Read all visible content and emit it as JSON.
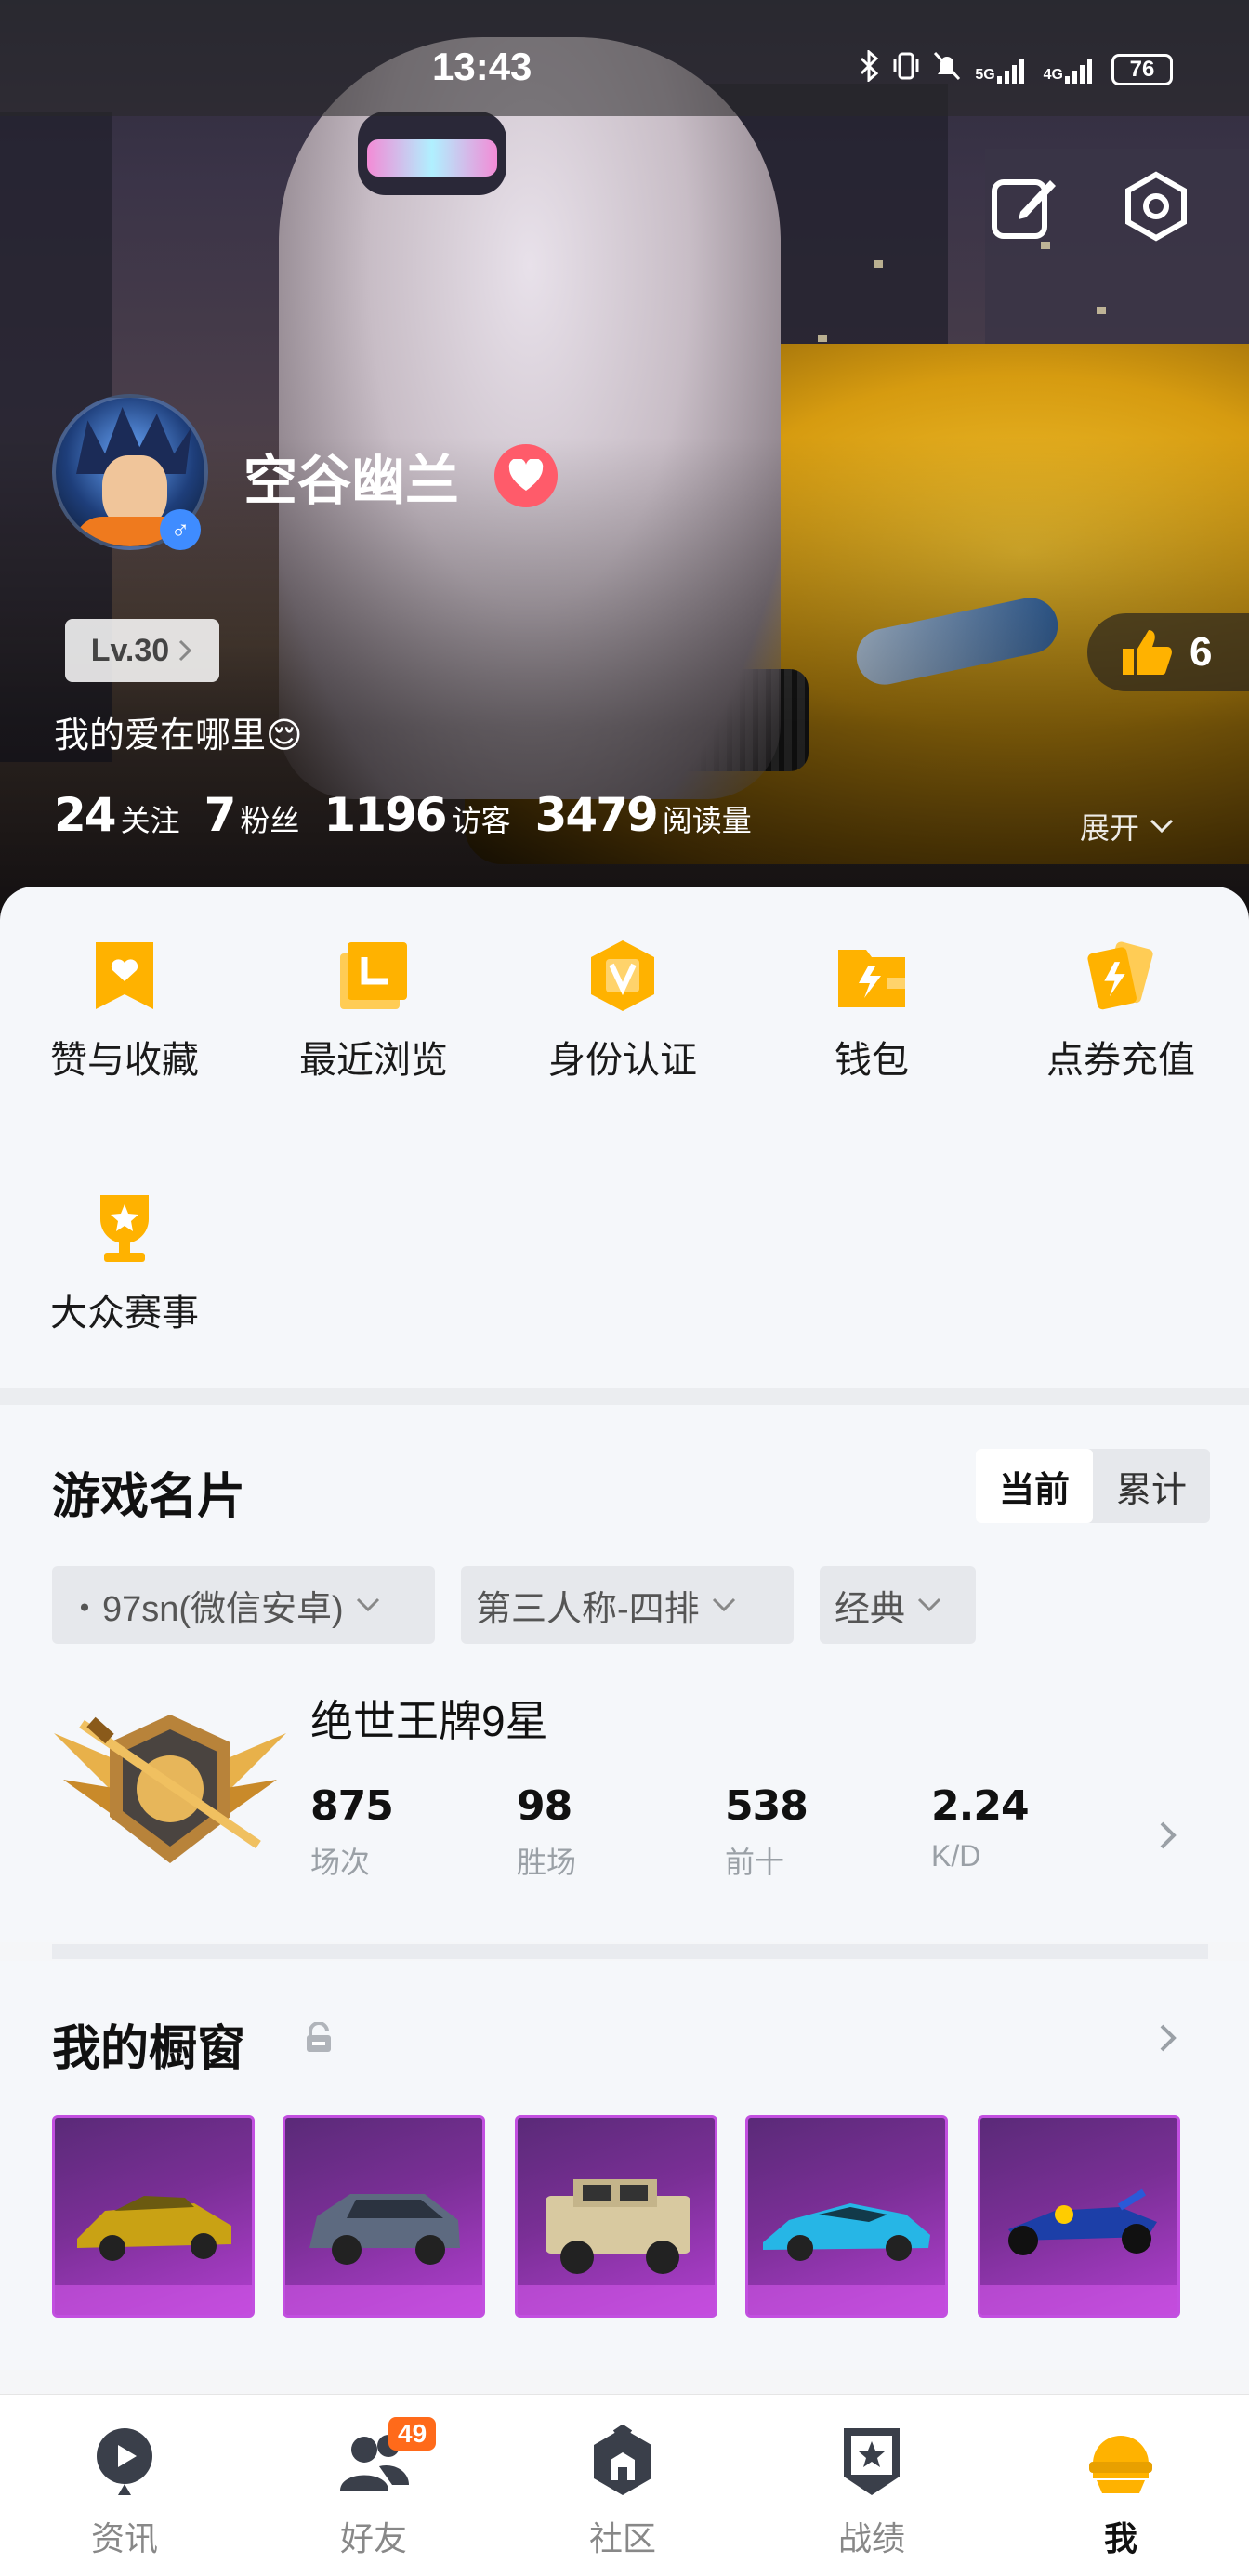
{
  "status_bar": {
    "time": "13:43",
    "signal_labels": [
      "5G",
      "4G"
    ],
    "battery": "76"
  },
  "profile": {
    "nickname": "空谷幽兰",
    "gender_symbol": "♂",
    "level_label": "Lv.30",
    "likes_count": "6",
    "signature": "我的爱在哪里😌",
    "stats": [
      {
        "value": "24",
        "label": "关注"
      },
      {
        "value": "7",
        "label": "粉丝"
      },
      {
        "value": "1196",
        "label": "访客"
      },
      {
        "value": "3479",
        "label": "阅读量"
      }
    ],
    "expand_label": "展开"
  },
  "shortcuts": [
    {
      "label": "赞与收藏",
      "icon": "heart-bookmark-icon"
    },
    {
      "label": "最近浏览",
      "icon": "recent-icon"
    },
    {
      "label": "身份认证",
      "icon": "verify-v-icon"
    },
    {
      "label": "钱包",
      "icon": "wallet-icon"
    },
    {
      "label": "点券充值",
      "icon": "voucher-icon"
    },
    {
      "label": "大众赛事",
      "icon": "trophy-icon"
    }
  ],
  "game_card": {
    "title": "游戏名片",
    "toggle": {
      "current": "当前",
      "total": "累计"
    },
    "filters": [
      "・97sn(微信安卓)",
      "第三人称-四排",
      "经典"
    ],
    "rank_name": "绝世王牌9星",
    "stats": [
      {
        "value": "875",
        "label": "场次"
      },
      {
        "value": "98",
        "label": "胜场"
      },
      {
        "value": "538",
        "label": "前十"
      },
      {
        "value": "2.24",
        "label": "K/D"
      }
    ]
  },
  "showcase": {
    "title": "我的橱窗",
    "items": [
      "gold-sports-car",
      "gray-suv",
      "armored-jeep",
      "blue-supercar",
      "kart-racer"
    ]
  },
  "tabbar": [
    {
      "label": "资讯",
      "icon": "news-icon"
    },
    {
      "label": "好友",
      "icon": "friends-icon",
      "badge": "49"
    },
    {
      "label": "社区",
      "icon": "community-icon"
    },
    {
      "label": "战绩",
      "icon": "record-icon"
    },
    {
      "label": "我",
      "icon": "me-helmet-icon"
    }
  ],
  "colors": {
    "accent_orange": "#ffb200",
    "badge_orange": "#ff6a1a",
    "showcase_purple": "#7a2f96"
  }
}
